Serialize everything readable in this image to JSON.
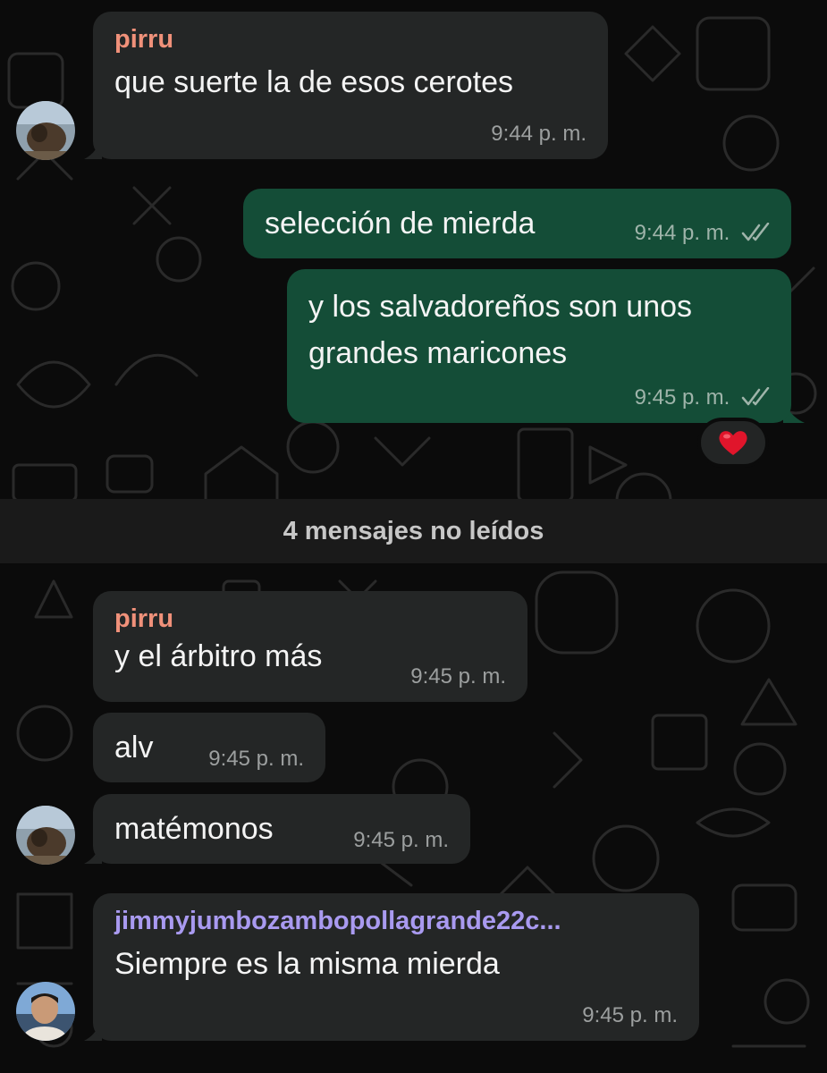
{
  "colors": {
    "incoming_bubble": "#242626",
    "outgoing_bubble": "#144d37",
    "sender_pirru": "#f0917a",
    "sender_jimmy": "#a99af0",
    "timestamp": "#9c9f9f"
  },
  "messages": [
    {
      "id": "m1",
      "direction": "incoming",
      "sender": "pirru",
      "text": "que suerte la de esos cerotes",
      "time": "9:44 p. m."
    },
    {
      "id": "m2",
      "direction": "outgoing",
      "text": "selección de mierda",
      "time": "9:44 p. m.",
      "status_icon": "double-check-icon"
    },
    {
      "id": "m3",
      "direction": "outgoing",
      "text": "y los salvadoreños son unos grandes maricones",
      "text_lines": [
        "y los salvadoreños son unos",
        "grandes maricones"
      ],
      "time": "9:45 p. m.",
      "status_icon": "double-check-icon",
      "reaction": "heart-icon"
    },
    {
      "id": "m4",
      "direction": "incoming",
      "sender": "pirru",
      "text": "y el árbitro más",
      "time": "9:45 p. m."
    },
    {
      "id": "m5",
      "direction": "incoming",
      "text": "alv",
      "time": "9:45 p. m."
    },
    {
      "id": "m6",
      "direction": "incoming",
      "text": "matémonos",
      "time": "9:45 p. m."
    },
    {
      "id": "m7",
      "direction": "incoming",
      "sender": "jimmyjumbozambopollagrande22c...",
      "text": "Siempre es la misma mierda",
      "time": "9:45 p. m."
    }
  ],
  "unread_divider": "4 mensajes no leídos"
}
